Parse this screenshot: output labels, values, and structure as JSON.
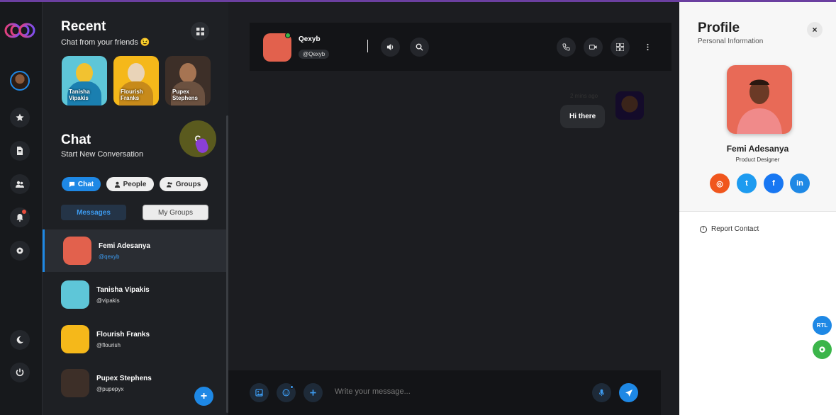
{
  "sidebar": {
    "recent_title": "Recent",
    "recent_subtitle": "Chat from your friends 😉",
    "stories": [
      {
        "name_line1": "Tanisha",
        "name_line2": "Vipakis"
      },
      {
        "name_line1": "Flourish",
        "name_line2": "Franks"
      },
      {
        "name_line1": "Pupex",
        "name_line2": "Stephens"
      }
    ],
    "chat_title": "Chat",
    "chat_subtitle": "Start New Conversation",
    "cursor_letter": "C",
    "pills": {
      "chat": "Chat",
      "people": "People",
      "groups": "Groups"
    },
    "tabs": {
      "messages": "Messages",
      "my_groups": "My Groups"
    },
    "conversations": [
      {
        "name": "Femi Adesanya",
        "handle": "@qexyb",
        "active": true
      },
      {
        "name": "Tanisha Vipakis",
        "handle": "@vipakis",
        "active": false
      },
      {
        "name": "Flourish Franks",
        "handle": "@flourish",
        "active": false
      },
      {
        "name": "Pupex Stephens",
        "handle": "@pupepyx",
        "active": false
      }
    ],
    "fab_label": "+"
  },
  "chat": {
    "contact_name": "Qexyb",
    "contact_handle": "@Qexyb",
    "messages": [
      {
        "text": "Hi there",
        "time": "2 mins ago"
      }
    ],
    "composer_placeholder": "Write your message..."
  },
  "profile": {
    "title": "Profile",
    "subtitle": "Personal Information",
    "close_label": "×",
    "name": "Femi Adesanya",
    "role": "Product Designer",
    "socials": [
      {
        "name": "instagram",
        "glyph": "◎",
        "color": "#f0561d"
      },
      {
        "name": "twitter",
        "glyph": "t",
        "color": "#1d9bf0"
      },
      {
        "name": "facebook",
        "glyph": "f",
        "color": "#1877f2"
      },
      {
        "name": "linkedin",
        "glyph": "in",
        "color": "#1e88e5"
      }
    ],
    "report_label": "Report Contact",
    "rtl_label": "RTL"
  },
  "colors": {
    "accent": "#1e88e5",
    "online": "#3bb54a",
    "settings_float": "#3bb54a"
  }
}
